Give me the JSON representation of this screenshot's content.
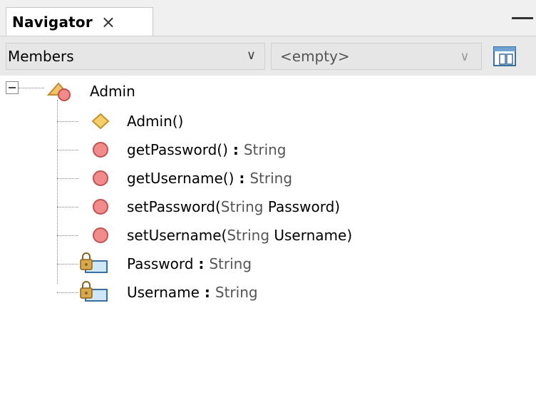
{
  "tab": {
    "title": "Navigator",
    "close_glyph": "×"
  },
  "toolbar": {
    "members_combo": "Members",
    "empty_combo": "<empty>",
    "chevron": "∨"
  },
  "tree": {
    "root": {
      "label": "Admin",
      "icon": "class-icon"
    },
    "items": [
      {
        "icon": "constructor-icon",
        "name": "Admin()",
        "sep": "",
        "type": ""
      },
      {
        "icon": "method-icon",
        "name": "getPassword()",
        "sep": " : ",
        "type": "String"
      },
      {
        "icon": "method-icon",
        "name": "getUsername()",
        "sep": " : ",
        "type": "String"
      },
      {
        "icon": "method-icon",
        "parts": [
          "setPassword(",
          "String",
          " Password)"
        ]
      },
      {
        "icon": "method-icon",
        "parts": [
          "setUsername(",
          "String",
          " Username)"
        ]
      },
      {
        "icon": "private-field-icon",
        "name": "Password",
        "sep": " : ",
        "type": "String"
      },
      {
        "icon": "private-field-icon",
        "name": "Username",
        "sep": " : ",
        "type": "String"
      }
    ]
  },
  "colors": {
    "method": "#f28b8b",
    "constructor": "#f6cf6a",
    "field": "#cfe8f7",
    "lock": "#d8a84a",
    "type_text": "#555555"
  }
}
